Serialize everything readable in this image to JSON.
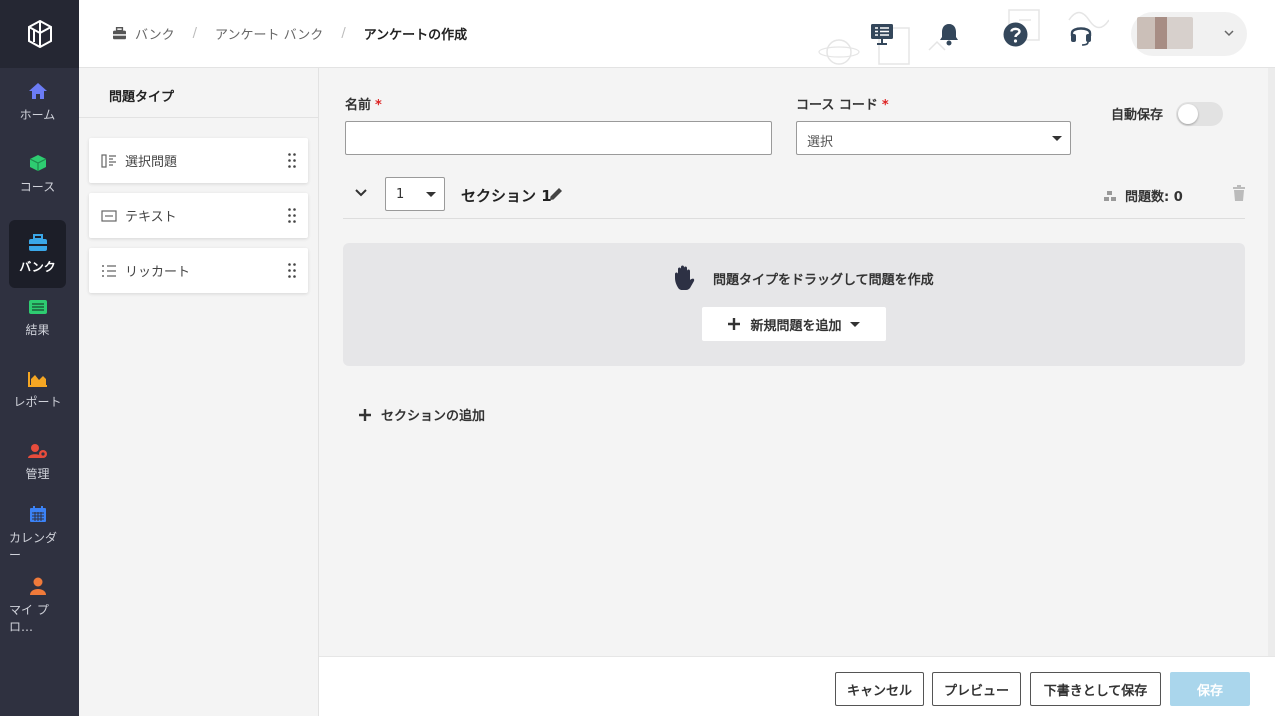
{
  "nav": {
    "items": [
      {
        "label": "ホーム",
        "icon": "home-icon",
        "color": "#6c7cf5"
      },
      {
        "label": "コース",
        "icon": "cube-icon",
        "color": "#2ecc71"
      },
      {
        "label": "バンク",
        "icon": "toolbox-icon",
        "color": "#3aa7e8",
        "active": true
      },
      {
        "label": "結果",
        "icon": "list-icon",
        "color": "#2ecc71"
      },
      {
        "label": "レポート",
        "icon": "area-chart-icon",
        "color": "#f5a623"
      },
      {
        "label": "管理",
        "icon": "user-gear-icon",
        "color": "#e74c3c"
      },
      {
        "label": "カレンダー",
        "icon": "calendar-icon",
        "color": "#3b82f6"
      },
      {
        "label": "マイ プロ…",
        "icon": "person-icon",
        "color": "#f07a3a"
      }
    ]
  },
  "header": {
    "breadcrumb": {
      "bank": "バンク",
      "survey_bank": "アンケート バンク",
      "current": "アンケートの作成"
    }
  },
  "qtypes": {
    "title": "問題タイプ",
    "items": [
      {
        "label": "選択問題",
        "icon": "multiple-choice-icon"
      },
      {
        "label": "テキスト",
        "icon": "text-box-icon"
      },
      {
        "label": "リッカート",
        "icon": "likert-list-icon"
      }
    ]
  },
  "form": {
    "name_label": "名前",
    "name_value": "",
    "course_label": "コース コード",
    "course_placeholder": "選択",
    "required_mark": "*",
    "autosave_label": "自動保存",
    "autosave_on": false
  },
  "section": {
    "number": "1",
    "title": "セクション 1",
    "count_label": "問題数: 0",
    "drop_hint": "問題タイプをドラッグして問題を作成",
    "add_question": "新規問題を追加",
    "add_section": "セクションの追加"
  },
  "footer": {
    "cancel": "キャンセル",
    "preview": "プレビュー",
    "save_draft": "下書きとして保存",
    "save": "保存"
  }
}
